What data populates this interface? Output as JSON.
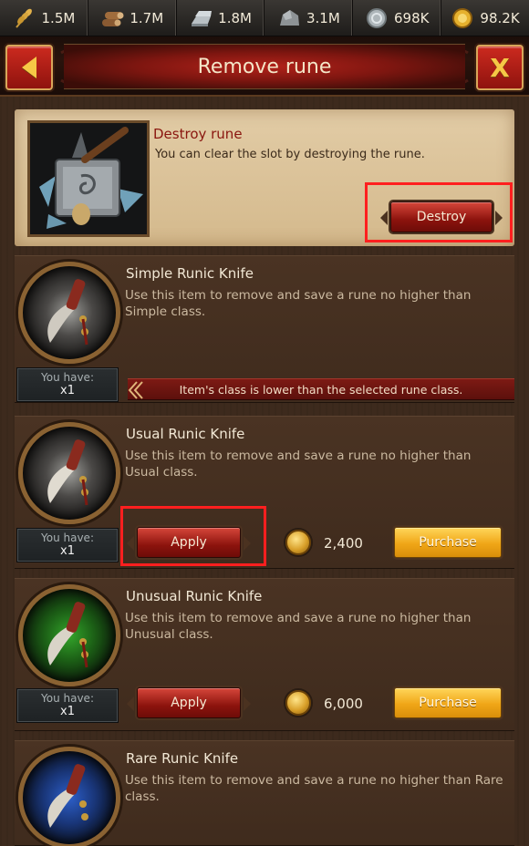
{
  "resources": [
    {
      "icon": "wheat-icon",
      "value": "1.5M"
    },
    {
      "icon": "wood-logs-icon",
      "value": "1.7M"
    },
    {
      "icon": "iron-ingot-icon",
      "value": "1.8M"
    },
    {
      "icon": "stone-icon",
      "value": "3.1M"
    },
    {
      "icon": "silver-icon",
      "value": "698K"
    },
    {
      "icon": "gold-coin-icon",
      "value": "98.2K"
    }
  ],
  "header": {
    "title": "Remove rune",
    "back_glyph": "back-arrow",
    "close_label": "X"
  },
  "destroy": {
    "title": "Destroy rune",
    "text": "You can clear the slot by destroying the rune.",
    "button_label": "Destroy"
  },
  "items": [
    {
      "name": "Simple Runic Knife",
      "desc": "Use this item to remove and save a rune no higher than Simple class.",
      "have_label": "You have:",
      "have_qty": "x1",
      "warning": "Item's class is lower than the selected rune class."
    },
    {
      "name": "Usual Runic Knife",
      "desc": "Use this item to remove and save a rune no higher than Usual class.",
      "have_label": "You have:",
      "have_qty": "x1",
      "apply_label": "Apply",
      "price": "2,400",
      "purchase_label": "Purchase"
    },
    {
      "name": "Unusual Runic Knife",
      "desc": "Use this item to remove and save a rune no higher than Unusual class.",
      "have_label": "You have:",
      "have_qty": "x1",
      "apply_label": "Apply",
      "price": "6,000",
      "purchase_label": "Purchase"
    },
    {
      "name": "Rare Runic Knife",
      "desc": "Use this item to remove and save a rune no higher than Rare class."
    }
  ],
  "colors": {
    "highlight": "#ff1f1f",
    "accent_red": "#8c130d",
    "accent_gold": "#f0a617"
  }
}
